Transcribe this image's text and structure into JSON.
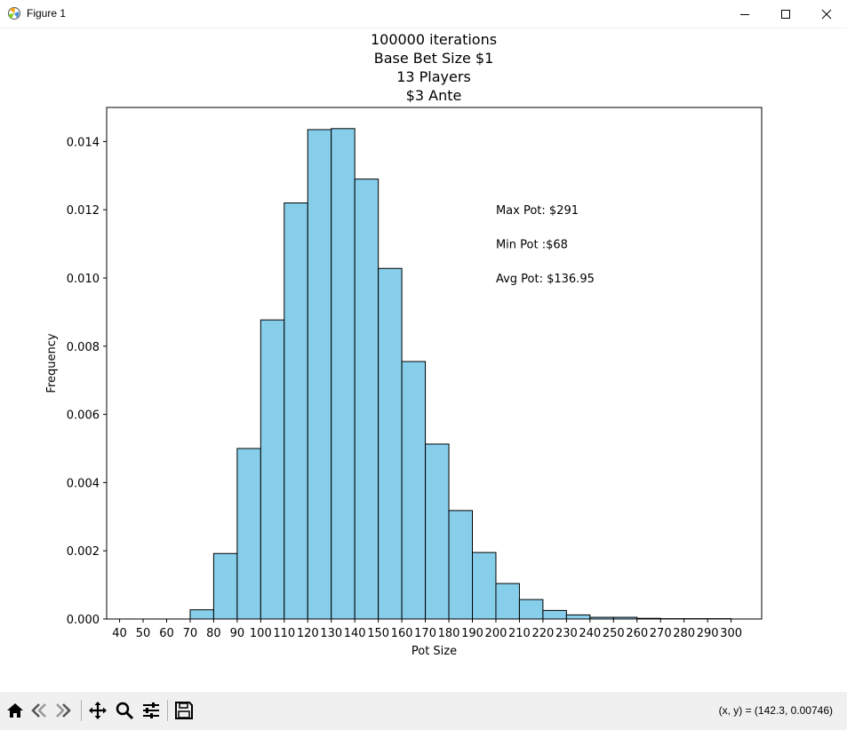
{
  "window": {
    "title": "Figure 1",
    "icons": [
      "matplotlib-icon",
      "minimize-icon",
      "maximize-icon",
      "close-icon"
    ]
  },
  "toolbar": {
    "buttons": [
      "home-icon",
      "back-icon",
      "forward-icon",
      "pan-icon",
      "zoom-icon",
      "configure-icon",
      "save-icon"
    ],
    "coords": "(x, y) = (142.3, 0.00746)"
  },
  "chart_data": {
    "type": "bar",
    "title_lines": [
      "100000 iterations",
      "Base Bet Size $1",
      "13 Players",
      "$3 Ante"
    ],
    "xlabel": "Pot Size",
    "ylabel": "Frequency",
    "xlim": [
      34.5,
      313
    ],
    "ylim": [
      0,
      0.015
    ],
    "xticks": [
      40,
      50,
      60,
      70,
      80,
      90,
      100,
      110,
      120,
      130,
      140,
      150,
      160,
      170,
      180,
      190,
      200,
      210,
      220,
      230,
      240,
      250,
      260,
      270,
      280,
      290,
      300
    ],
    "yticks": [
      0.0,
      0.002,
      0.004,
      0.006,
      0.008,
      0.01,
      0.012,
      0.014
    ],
    "ytick_labels": [
      "0.000",
      "0.002",
      "0.004",
      "0.006",
      "0.008",
      "0.010",
      "0.012",
      "0.014"
    ],
    "bins": [
      {
        "start": 70,
        "end": 80,
        "value": 0.00027
      },
      {
        "start": 80,
        "end": 90,
        "value": 0.00192
      },
      {
        "start": 90,
        "end": 100,
        "value": 0.005
      },
      {
        "start": 100,
        "end": 110,
        "value": 0.00877
      },
      {
        "start": 110,
        "end": 120,
        "value": 0.0122
      },
      {
        "start": 120,
        "end": 130,
        "value": 0.01435
      },
      {
        "start": 130,
        "end": 140,
        "value": 0.01438
      },
      {
        "start": 140,
        "end": 150,
        "value": 0.0129
      },
      {
        "start": 150,
        "end": 160,
        "value": 0.01028
      },
      {
        "start": 160,
        "end": 170,
        "value": 0.00755
      },
      {
        "start": 170,
        "end": 180,
        "value": 0.00513
      },
      {
        "start": 180,
        "end": 190,
        "value": 0.00318
      },
      {
        "start": 190,
        "end": 200,
        "value": 0.00195
      },
      {
        "start": 200,
        "end": 210,
        "value": 0.00104
      },
      {
        "start": 210,
        "end": 220,
        "value": 0.00057
      },
      {
        "start": 220,
        "end": 230,
        "value": 0.00025
      },
      {
        "start": 230,
        "end": 240,
        "value": 0.00012
      },
      {
        "start": 240,
        "end": 250,
        "value": 5e-05
      },
      {
        "start": 250,
        "end": 260,
        "value": 5e-05
      },
      {
        "start": 260,
        "end": 270,
        "value": 2e-05
      },
      {
        "start": 270,
        "end": 280,
        "value": 1e-05
      },
      {
        "start": 280,
        "end": 290,
        "value": 1e-05
      },
      {
        "start": 290,
        "end": 300,
        "value": 1e-05
      }
    ],
    "bar_color": "#87ceeb",
    "edge_color": "#000000",
    "annotations": [
      {
        "text": "Max Pot: $291",
        "x": 200,
        "y": 0.012
      },
      {
        "text": "Min Pot :$68",
        "x": 200,
        "y": 0.011
      },
      {
        "text": "Avg Pot: $136.95",
        "x": 200,
        "y": 0.01
      }
    ],
    "grid": false
  }
}
